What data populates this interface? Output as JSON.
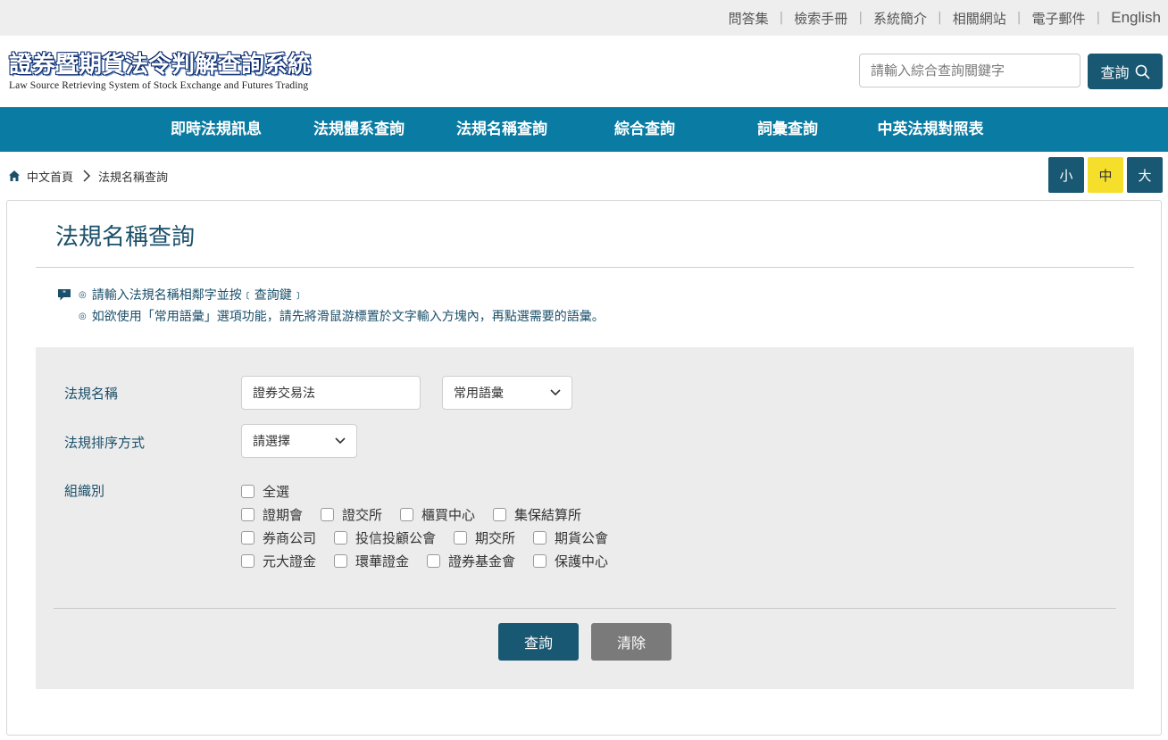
{
  "top_links": [
    "問答集",
    "檢索手冊",
    "系統簡介",
    "相關網站",
    "電子郵件",
    "English"
  ],
  "logo": {
    "zh": "證券暨期貨法令判解查詢系統",
    "en": "Law Source Retrieving System of Stock Exchange and Futures Trading"
  },
  "search": {
    "placeholder": "請輸入綜合查詢關鍵字",
    "button_label": "查詢"
  },
  "nav": [
    "即時法規訊息",
    "法規體系查詢",
    "法規名稱查詢",
    "綜合查詢",
    "詞彙查詢",
    "中英法規對照表"
  ],
  "breadcrumb": {
    "home": "中文首頁",
    "current": "法規名稱查詢"
  },
  "font_size": {
    "small": "小",
    "medium": "中",
    "large": "大",
    "selected": "中"
  },
  "page_title": "法規名稱查詢",
  "notes": [
    "請輸入法規名稱相鄰字並按﹝查詢鍵﹞",
    "如欲使用「常用語彙」選項功能，請先將滑鼠游標置於文字輸入方塊內，再點選需要的語彙。"
  ],
  "form": {
    "name_label": "法規名稱",
    "name_value": "證券交易法",
    "vocab_select": "常用語彙",
    "sort_label": "法規排序方式",
    "sort_select": "請選擇",
    "org_label": "組織別",
    "orgs": [
      [
        "全選"
      ],
      [
        "證期會",
        "證交所",
        "櫃買中心",
        "集保結算所"
      ],
      [
        "券商公司",
        "投信投顧公會",
        "期交所",
        "期貨公會"
      ],
      [
        "元大證金",
        "環華證金",
        "證券基金會",
        "保護中心"
      ]
    ],
    "query_button": "查詢",
    "clear_button": "清除"
  },
  "colors": {
    "nav_bg": "#0a7ca3",
    "dark_button": "#195872",
    "active_size": "#f5df2a",
    "form_bg": "#ececec"
  }
}
